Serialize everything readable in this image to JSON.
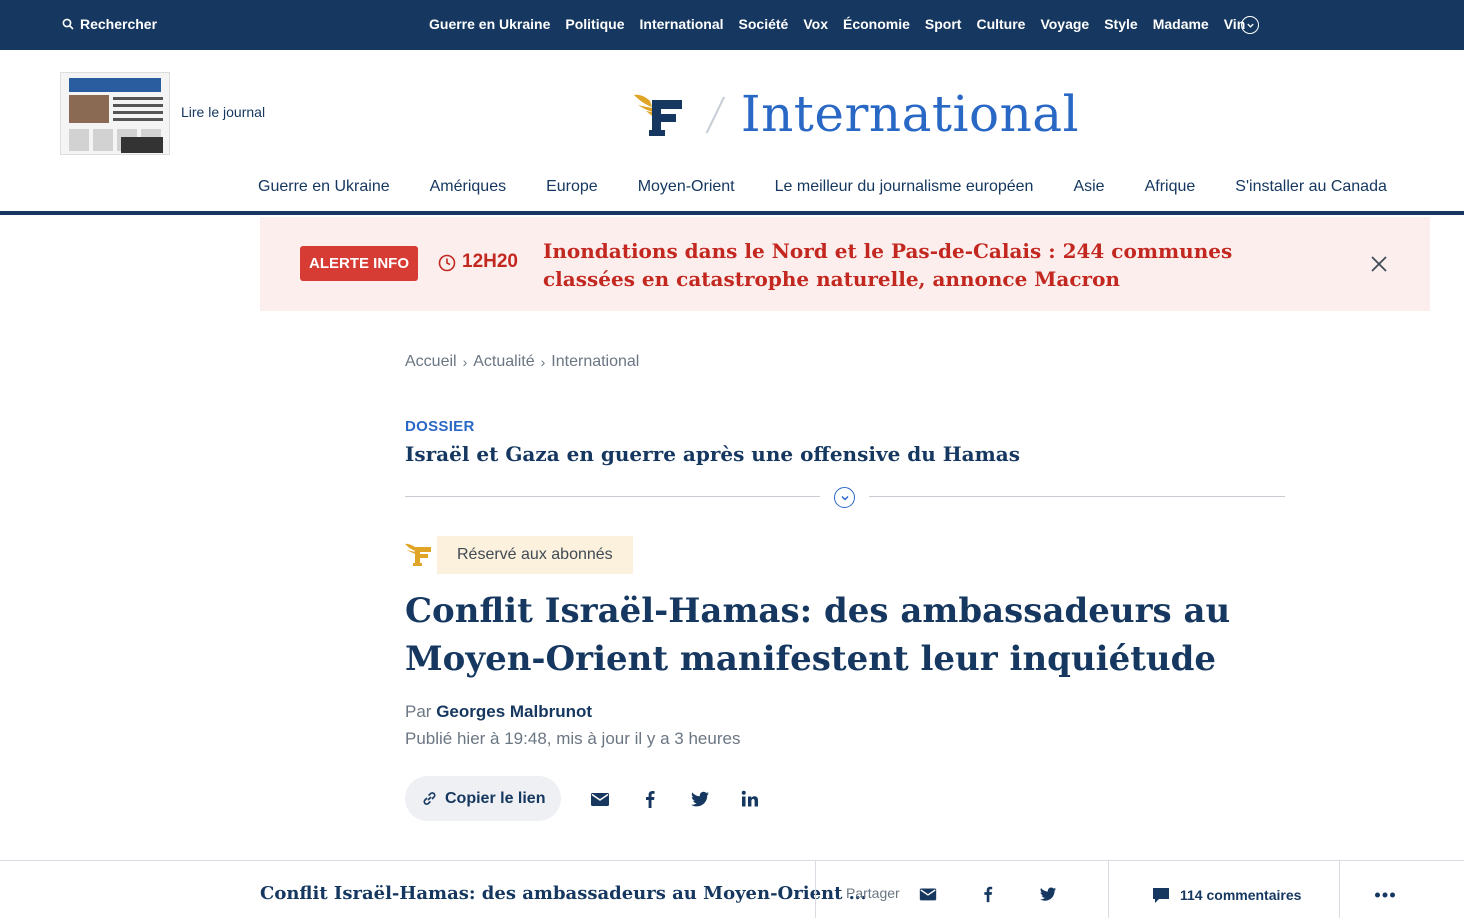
{
  "topbar": {
    "search_label": "Rechercher",
    "nav": [
      "Guerre en Ukraine",
      "Politique",
      "International",
      "Société",
      "Vox",
      "Économie",
      "Sport",
      "Culture",
      "Voyage",
      "Style",
      "Madame",
      "Vin"
    ]
  },
  "header": {
    "read_paper_label": "Lire le journal",
    "paper_masthead": "LE FIGARO",
    "section_title": "International"
  },
  "subnav": [
    "Guerre en Ukraine",
    "Amériques",
    "Europe",
    "Moyen-Orient",
    "Le meilleur du journalisme européen",
    "Asie",
    "Afrique",
    "S'installer au Canada"
  ],
  "alert": {
    "badge": "ALERTE INFO",
    "time": "12H20",
    "headline": "Inondations dans le Nord et le Pas-de-Calais : 244 communes classées en catastrophe naturelle, annonce Macron"
  },
  "breadcrumb": [
    "Accueil",
    "Actualité",
    "International"
  ],
  "dossier": {
    "label": "DOSSIER",
    "title": "Israël et Gaza en guerre après une offensive du Hamas"
  },
  "article": {
    "premium_label": "Réservé aux abonnés",
    "title": "Conflit Israël-Hamas: des ambassadeurs au Moyen-Orient manifestent leur inquiétude",
    "byline_prefix": "Par",
    "author": "Georges Malbrunot",
    "published": "Publié hier à 19:48, mis à jour il y a 3 heures",
    "copy_link_label": "Copier le lien"
  },
  "bottombar": {
    "title": "Conflit Israël-Hamas: des ambassadeurs au Moyen-Orient …",
    "share_label": "Partager",
    "comments_label": "114 commentaires"
  },
  "colors": {
    "navy": "#163860",
    "accent_blue": "#2a68c6",
    "alert_red": "#c2281f",
    "alert_bg": "#fdeeee",
    "premium_gold": "#e0a526"
  },
  "icons": [
    "search-icon",
    "chevron-down-icon",
    "clock-icon",
    "close-icon",
    "link-icon",
    "email-icon",
    "facebook-icon",
    "twitter-icon",
    "linkedin-icon",
    "comment-icon",
    "more-icon"
  ]
}
